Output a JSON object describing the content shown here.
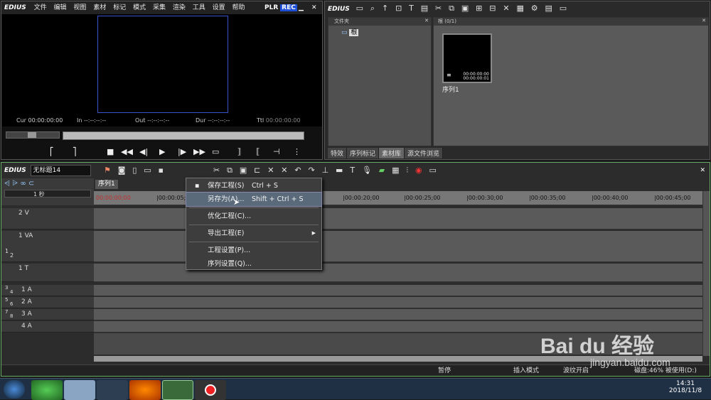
{
  "app": {
    "title": "EDIUS",
    "menu": [
      "文件",
      "编辑",
      "视图",
      "素材",
      "标记",
      "模式",
      "采集",
      "渲染",
      "工具",
      "设置",
      "帮助"
    ],
    "plr": "PLR",
    "rec": "REC"
  },
  "player": {
    "cur_label": "Cur",
    "cur": "00:00:00:00",
    "in_label": "In",
    "in": "--:--:--:--",
    "out_label": "Out",
    "out": "--:--:--:--",
    "dur_label": "Dur",
    "dur": "--:--:--:--",
    "ttl_label": "Ttl",
    "ttl": "00:00:00:00"
  },
  "bin": {
    "title": "EDIUS",
    "folder_header": "文件夹",
    "root_label": "根",
    "crumb": "根 (0/1)",
    "clip_name": "序列1",
    "clip_tc1": "00:00:00:00",
    "clip_tc2": "00:00:00:01",
    "tabs": [
      "特效",
      "序列标记",
      "素材库",
      "源文件浏览"
    ]
  },
  "timeline": {
    "app": "EDIUS",
    "project": "无标题14",
    "sequence_tab": "序列1",
    "scale": "1 秒",
    "ruler": [
      "00:00:00;00",
      "|00:00:05;",
      "|00:00:20;00",
      "|00:00:25;00",
      "|00:00:30;00",
      "|00:00:35;00",
      "|00:00:40;00",
      "|00:00:45;00"
    ],
    "tracks": [
      {
        "name": "2 V"
      },
      {
        "name": "1 VA"
      },
      {
        "name": "1 T"
      },
      {
        "name": "1 A"
      },
      {
        "name": "2 A"
      },
      {
        "name": "3 A"
      },
      {
        "name": "4 A"
      }
    ],
    "track_nums": [
      "1",
      "2",
      "3",
      "4",
      "5",
      "6",
      "7",
      "8"
    ]
  },
  "menu": {
    "items": [
      {
        "label": "保存工程(S)",
        "shortcut": "Ctrl + S"
      },
      {
        "label": "另存为(A)...",
        "shortcut": "Shift + Ctrl + S"
      },
      {
        "label": "优化工程(C)...",
        "shortcut": ""
      },
      {
        "label": "导出工程(E)",
        "shortcut": ""
      },
      {
        "label": "工程设置(P)...",
        "shortcut": ""
      },
      {
        "label": "序列设置(Q)...",
        "shortcut": ""
      }
    ]
  },
  "status": {
    "pause": "暂停",
    "insert": "插入模式",
    "ripple": "波纹开启",
    "disk": "磁盘:46% 被使用(D:)"
  },
  "taskbar": {
    "time": "14:31",
    "date": "2018/11/8"
  },
  "watermark": {
    "brand": "Bai du 经验",
    "url": "jingyan.baidu.com"
  },
  "colors": {
    "accent": "#2a4fc8",
    "rec": "#1e4fd8",
    "timecode_red": "#c03030"
  }
}
